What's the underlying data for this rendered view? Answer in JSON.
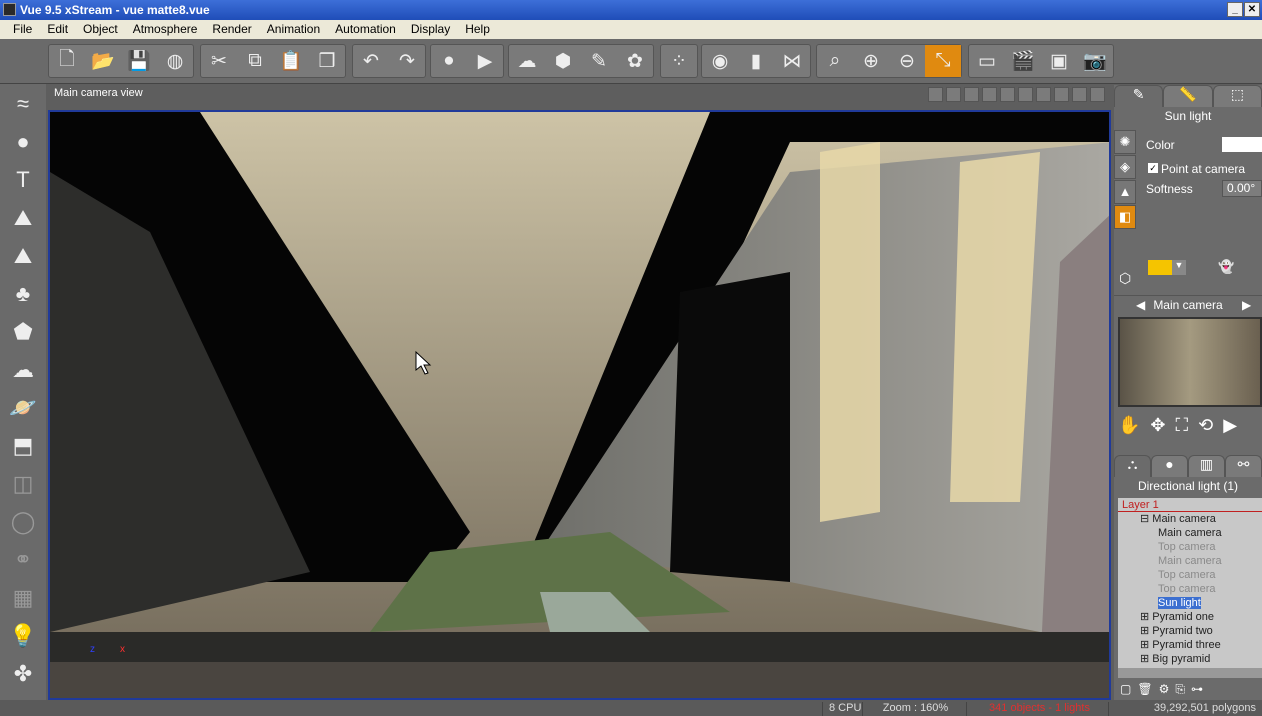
{
  "window": {
    "title": "Vue 9.5 xStream - vue matte8.vue",
    "min": "_",
    "close": "✕"
  },
  "menu": [
    "File",
    "Edit",
    "Object",
    "Atmosphere",
    "Render",
    "Animation",
    "Automation",
    "Display",
    "Help"
  ],
  "toolbar": {
    "groups": [
      [
        {
          "icon": "new-file-icon",
          "g": "🗋"
        },
        {
          "icon": "open-folder-icon",
          "g": "📂"
        },
        {
          "icon": "save-icon",
          "g": "💾"
        },
        {
          "icon": "globe-icon",
          "g": "◍"
        }
      ],
      [
        {
          "icon": "cut-icon",
          "g": "✂"
        },
        {
          "icon": "copy-icon",
          "g": "⧉"
        },
        {
          "icon": "paste-icon",
          "g": "📋"
        },
        {
          "icon": "duplicate-icon",
          "g": "❒"
        }
      ],
      [
        {
          "icon": "undo-icon",
          "g": "↶"
        },
        {
          "icon": "redo-icon",
          "g": "↷"
        }
      ],
      [
        {
          "icon": "record-icon",
          "g": "●"
        },
        {
          "icon": "play-icon",
          "g": "▶"
        }
      ],
      [
        {
          "icon": "atmosphere-icon",
          "g": "☁"
        },
        {
          "icon": "object-cube-icon",
          "g": "⬢"
        },
        {
          "icon": "brush-icon",
          "g": "✎"
        },
        {
          "icon": "plant-icon",
          "g": "✿"
        }
      ],
      [
        {
          "icon": "material-balls-icon",
          "g": "⁘"
        }
      ],
      [
        {
          "icon": "render-sphere-icon",
          "g": "◉"
        },
        {
          "icon": "align-icon",
          "g": "▮"
        },
        {
          "icon": "mirror-icon",
          "g": "⋈"
        }
      ],
      [
        {
          "icon": "zoom-region-icon",
          "g": "⌕"
        },
        {
          "icon": "zoom-in-icon",
          "g": "⊕"
        },
        {
          "icon": "zoom-out-icon",
          "g": "⊖"
        },
        {
          "icon": "fit-view-icon",
          "g": "⤡"
        }
      ],
      [
        {
          "icon": "film-strip-icon",
          "g": "▭"
        },
        {
          "icon": "clapper-icon",
          "g": "🎬"
        },
        {
          "icon": "render-frame-icon",
          "g": "▣"
        },
        {
          "icon": "camera-icon",
          "g": "📷"
        }
      ]
    ]
  },
  "left_tools": [
    {
      "icon": "water-plane-icon",
      "g": "≈"
    },
    {
      "icon": "sphere-icon",
      "g": "●"
    },
    {
      "icon": "text-icon",
      "g": "T"
    },
    {
      "icon": "terrain-icon",
      "g": "⛰"
    },
    {
      "icon": "procedural-terrain-icon",
      "g": "⛰"
    },
    {
      "icon": "tree-icon",
      "g": "♣"
    },
    {
      "icon": "rock-icon",
      "g": "⬟"
    },
    {
      "icon": "cloud-icon",
      "g": "☁"
    },
    {
      "icon": "planet-icon",
      "g": "🪐"
    },
    {
      "icon": "import-object-icon",
      "g": "⬒"
    },
    {
      "icon": "boolean-icon",
      "g": "◫",
      "dim": true
    },
    {
      "icon": "metablob-icon",
      "g": "◯",
      "dim": true
    },
    {
      "icon": "hyperblob-icon",
      "g": "⚭",
      "dim": true
    },
    {
      "icon": "group-icon",
      "g": "▦",
      "dim": true
    },
    {
      "icon": "light-bulb-icon",
      "g": "💡"
    },
    {
      "icon": "wind-icon",
      "g": "✤"
    }
  ],
  "viewport": {
    "title": "Main camera view"
  },
  "panel": {
    "object_name": "Sun light",
    "color_label": "Color",
    "point_at_camera": "Point at camera",
    "point_checked": true,
    "softness_label": "Softness",
    "softness_value": "0.00°",
    "swatch_color": "#f5c400",
    "camera_selector": "Main camera",
    "group_title": "Directional light (1)",
    "tree": [
      {
        "label": "Layer 1",
        "cls": "layer",
        "ind": 0
      },
      {
        "label": "Main camera",
        "ind": 1,
        "pre": "⊟ "
      },
      {
        "label": "Main camera",
        "ind": 2
      },
      {
        "label": "Top camera",
        "ind": 2,
        "dim": true
      },
      {
        "label": "Main camera",
        "ind": 2,
        "dim": true
      },
      {
        "label": "Top camera",
        "ind": 2,
        "dim": true
      },
      {
        "label": "Top camera",
        "ind": 2,
        "dim": true
      },
      {
        "label": "Sun light",
        "ind": 2,
        "sel": true
      },
      {
        "label": "Pyramid one",
        "ind": 1,
        "pre": "⊞ "
      },
      {
        "label": "Pyramid two",
        "ind": 1,
        "pre": "⊞ "
      },
      {
        "label": "Pyramid three",
        "ind": 1,
        "pre": "⊞ "
      },
      {
        "label": "Big pyramid",
        "ind": 1,
        "pre": "⊞ "
      }
    ]
  },
  "status": {
    "cpu": "8 CPU",
    "zoom": "Zoom : 160%",
    "objects": "341 objects - 1 lights",
    "polygons": "39,292,501 polygons"
  }
}
